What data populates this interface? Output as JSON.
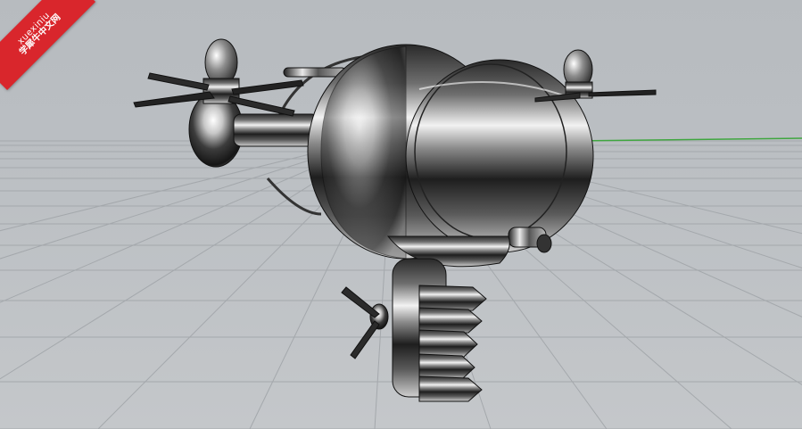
{
  "viewport": {
    "name": "perspective-viewport",
    "background_color": "#babec2",
    "grid_color": "#a3a7ab",
    "x_axis_color": "#3fa63f"
  },
  "model": {
    "name": "airship-model",
    "material": "chrome"
  },
  "watermark": {
    "line1": "xuexiniu",
    "line2": "学犀牛中文网",
    "color": "#d9262c"
  }
}
